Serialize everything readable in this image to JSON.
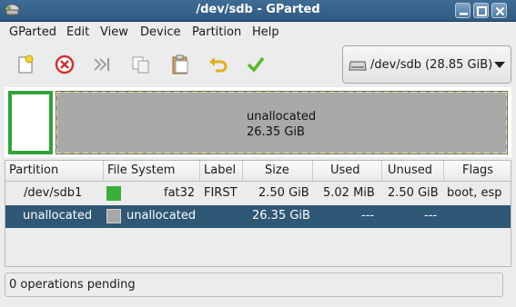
{
  "window": {
    "title": "/dev/sdb - GParted"
  },
  "menu": [
    "GParted",
    "Edit",
    "View",
    "Device",
    "Partition",
    "Help"
  ],
  "toolbar": {
    "buttons": [
      "new-partition",
      "delete-partition",
      "resize-move",
      "copy",
      "paste",
      "undo",
      "apply"
    ]
  },
  "device_selector": {
    "value": "/dev/sdb (28.85 GiB)"
  },
  "visual": {
    "unallocated_label": "unallocated",
    "unallocated_size": "26.35 GiB"
  },
  "table": {
    "headers": [
      "Partition",
      "File System",
      "Label",
      "Size",
      "Used",
      "Unused",
      "Flags"
    ],
    "rows": [
      {
        "partition": "/dev/sdb1",
        "fs_color": "#3cae3c",
        "filesystem": "fat32",
        "label": "FIRST",
        "size": "2.50 GiB",
        "used": "5.02 MiB",
        "unused": "2.50 GiB",
        "flags": "boot, esp",
        "selected": false
      },
      {
        "partition": "unallocated",
        "fs_color": "#a6a6a6",
        "filesystem": "unallocated",
        "label": "",
        "size": "26.35 GiB",
        "used": "---",
        "unused": "---",
        "flags": "",
        "selected": true
      }
    ]
  },
  "status": {
    "text": "0 operations pending"
  },
  "colors": {
    "titlebar": "#3a6690",
    "selection": "#2f5776",
    "fat32": "#3cae3c",
    "unallocated": "#a9a9a9"
  }
}
